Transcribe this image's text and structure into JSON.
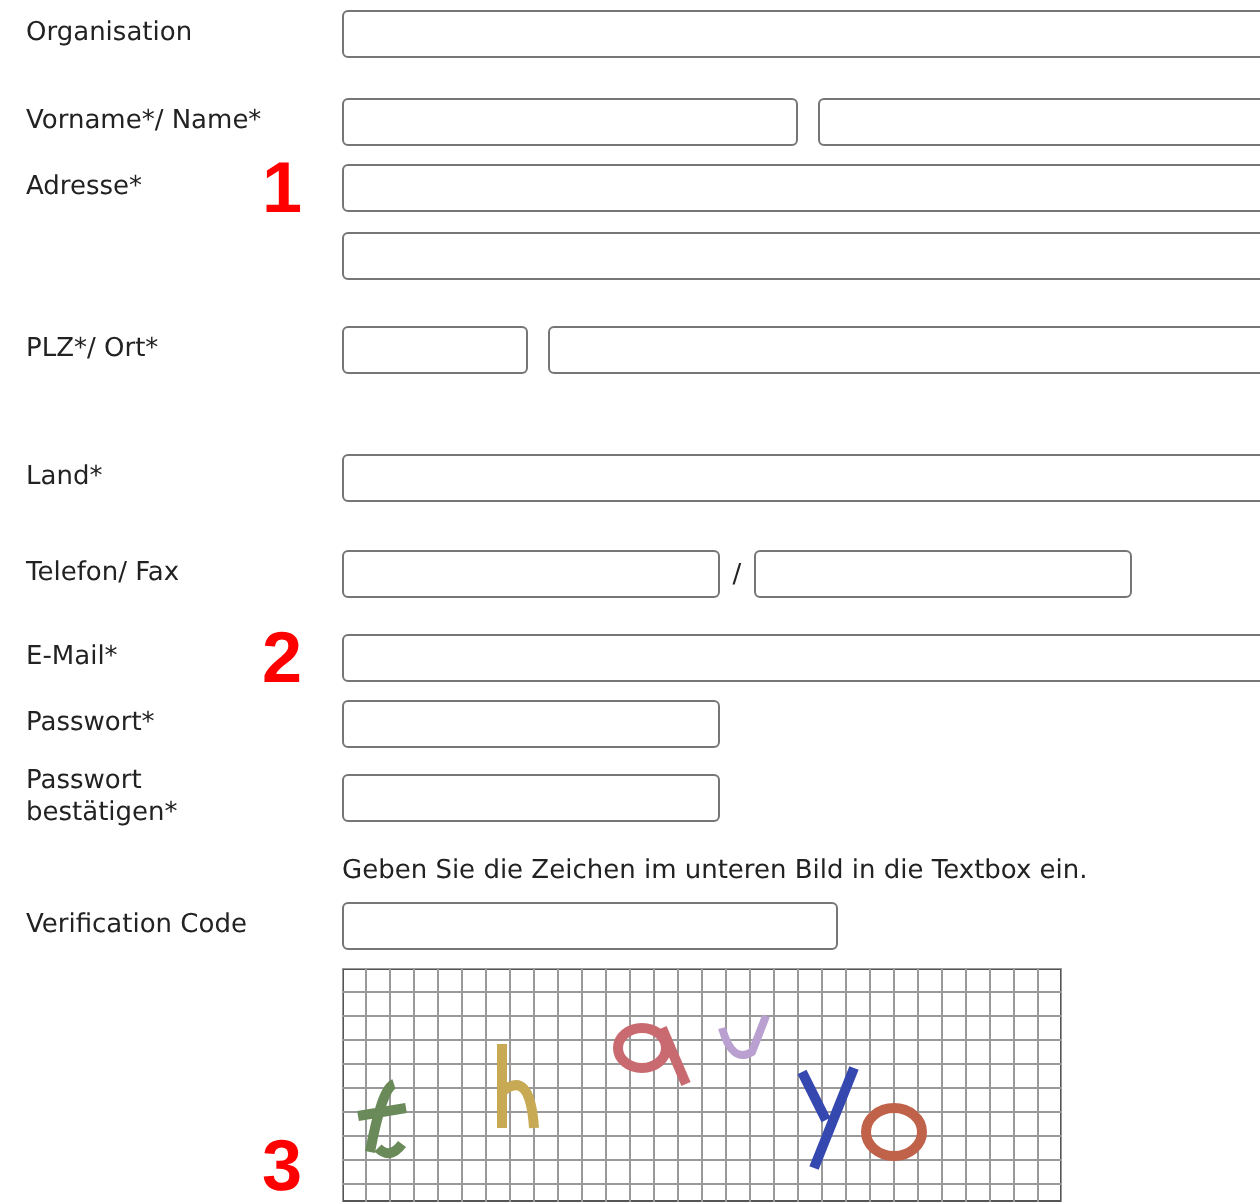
{
  "rows": [
    {
      "kind": "wide",
      "label": "Organisation"
    },
    {
      "kind": "double",
      "label": "Vorname*/ Name*"
    },
    {
      "kind": "wide",
      "label": "Adresse*",
      "annotation": "1"
    },
    {
      "kind": "wide"
    },
    {
      "kind": "plz",
      "label": "PLZ*/ Ort*"
    },
    {
      "kind": "wide",
      "label": "Land*"
    },
    {
      "kind": "phone",
      "label": "Telefon/ Fax",
      "separator": "/"
    },
    {
      "kind": "wide",
      "label": "E-Mail*",
      "annotation": "2"
    },
    {
      "kind": "short",
      "label": "Passwort*"
    },
    {
      "kind": "short",
      "label": "Passwort bestätigen*"
    },
    {
      "kind": "hint",
      "text": "Geben Sie die Zeichen im unteren Bild in die Textbox ein."
    },
    {
      "kind": "medium",
      "label": "Verification Code"
    },
    {
      "kind": "captcha",
      "annotation": "3"
    }
  ]
}
